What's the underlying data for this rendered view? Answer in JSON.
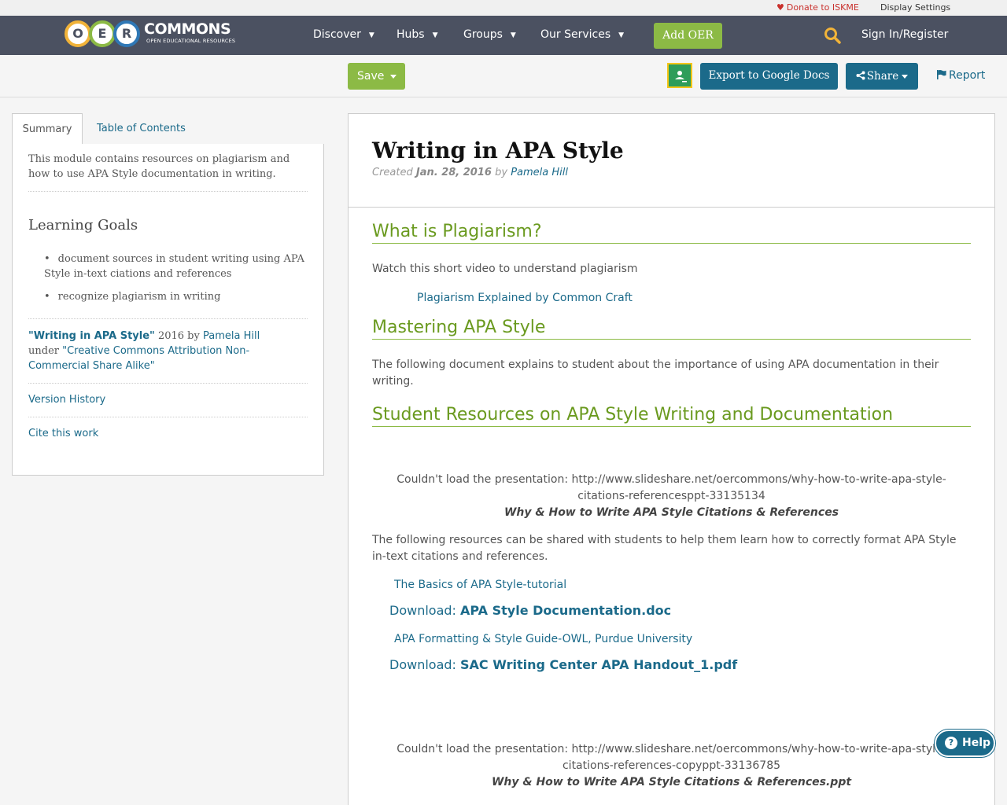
{
  "util": {
    "donate": "Donate to ISKME",
    "display_settings": "Display Settings"
  },
  "logo": {
    "letters": [
      "O",
      "E",
      "R"
    ],
    "word": "COMMONS",
    "sub": "OPEN EDUCATIONAL RESOURCES"
  },
  "nav": {
    "items": [
      {
        "label": "Discover"
      },
      {
        "label": "Hubs"
      },
      {
        "label": "Groups"
      },
      {
        "label": "Our Services"
      }
    ],
    "add_oer": "Add OER",
    "sign_in": "Sign In/Register"
  },
  "toolbar": {
    "save": "Save",
    "export": "Export to Google Docs",
    "share": "Share",
    "report": "Report"
  },
  "sidebar": {
    "tabs": [
      "Summary",
      "Table of Contents"
    ],
    "summary": "This module contains resources on plagiarism and how to use APA Style documentation in writing.",
    "learning_goals_title": "Learning Goals",
    "goals": [
      "document sources in student writing using APA Style in-text ciations and references",
      "recognize plagiarism in writing"
    ],
    "license": {
      "title": "\"Writing in APA Style\"",
      "year_by": "2016 by",
      "author": "Pamela Hill",
      "under": "under",
      "license_name": "\"Creative Commons Attribution Non-Commercial Share Alike\""
    },
    "version_history": "Version History",
    "cite": "Cite this work"
  },
  "main": {
    "title": "Writing in APA Style",
    "created_label": "Created",
    "created_date": "Jan. 28, 2016",
    "by": "by",
    "author": "Pamela Hill",
    "sections": {
      "s1_title": "What is Plagiarism?",
      "s1_text": "Watch this short video to understand plagiarism",
      "s1_link": "Plagiarism Explained by Common Craft",
      "s2_title": "Mastering APA Style",
      "s2_text": "The following document explains to student about the importance of using APA documentation in their writing.",
      "s3_title": "Student Resources on APA Style Writing and Documentation",
      "pres1_error": "Couldn't load the presentation: http://www.slideshare.net/oercommons/why-how-to-write-apa-style-citations-referencesppt-33135134",
      "pres1_caption": "Why & How to Write APA Style Citations & References",
      "s3_text": "The following resources can be shared with students to help them learn how to correctly format APA Style in-text citations and references.",
      "link_basics": "The Basics of APA Style-tutorial",
      "download_label": "Download:",
      "download1": "APA Style Documentation.doc",
      "link_owl": "APA Formatting & Style Guide-OWL, Purdue University",
      "download2": "SAC Writing Center APA Handout_1.pdf",
      "pres2_error": "Couldn't load the presentation: http://www.slideshare.net/oercommons/why-how-to-write-apa-style-citations-references-copyppt-33136785",
      "pres2_caption": "Why & How to Write APA Style Citations & References.ppt"
    }
  },
  "help": "Help",
  "colors": {
    "nav_bg": "#4b5161",
    "green": "#8cba45",
    "teal": "#1b6a8a",
    "heading_green": "#6a9a1f"
  }
}
